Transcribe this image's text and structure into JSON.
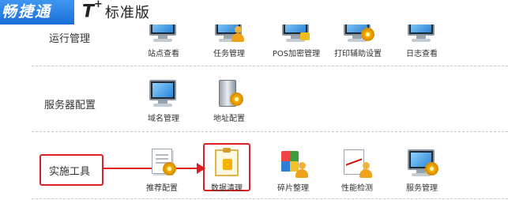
{
  "header": {
    "brand": "畅捷通",
    "product_mark": "T",
    "product_sup": "+",
    "edition": "标准版",
    "brand_color": "#2a80e6"
  },
  "sections": [
    {
      "title": "运行管理",
      "items": [
        {
          "label": "站点查看",
          "icon": "monitor-icon"
        },
        {
          "label": "任务管理",
          "icon": "monitor-person-icon"
        },
        {
          "label": "POS加密管理",
          "icon": "monitor-lock-icon"
        },
        {
          "label": "打印辅助设置",
          "icon": "monitor-gear-icon"
        },
        {
          "label": "日志查看",
          "icon": "monitor-icon"
        }
      ]
    },
    {
      "title": "服务器配置",
      "items": [
        {
          "label": "域名管理",
          "icon": "monitor-icon"
        },
        {
          "label": "地址配置",
          "icon": "server-gear-icon"
        }
      ]
    },
    {
      "title": "实施工具",
      "items": [
        {
          "label": "推荐配置",
          "icon": "document-gear-icon"
        },
        {
          "label": "数据清理",
          "icon": "clipboard-icon"
        },
        {
          "label": "碎片整理",
          "icon": "tiles-person-icon"
        },
        {
          "label": "性能检测",
          "icon": "pulse-person-icon"
        },
        {
          "label": "服务管理",
          "icon": "monitor-gear-icon"
        }
      ]
    }
  ],
  "annotation": {
    "highlight_color": "#e02020"
  }
}
